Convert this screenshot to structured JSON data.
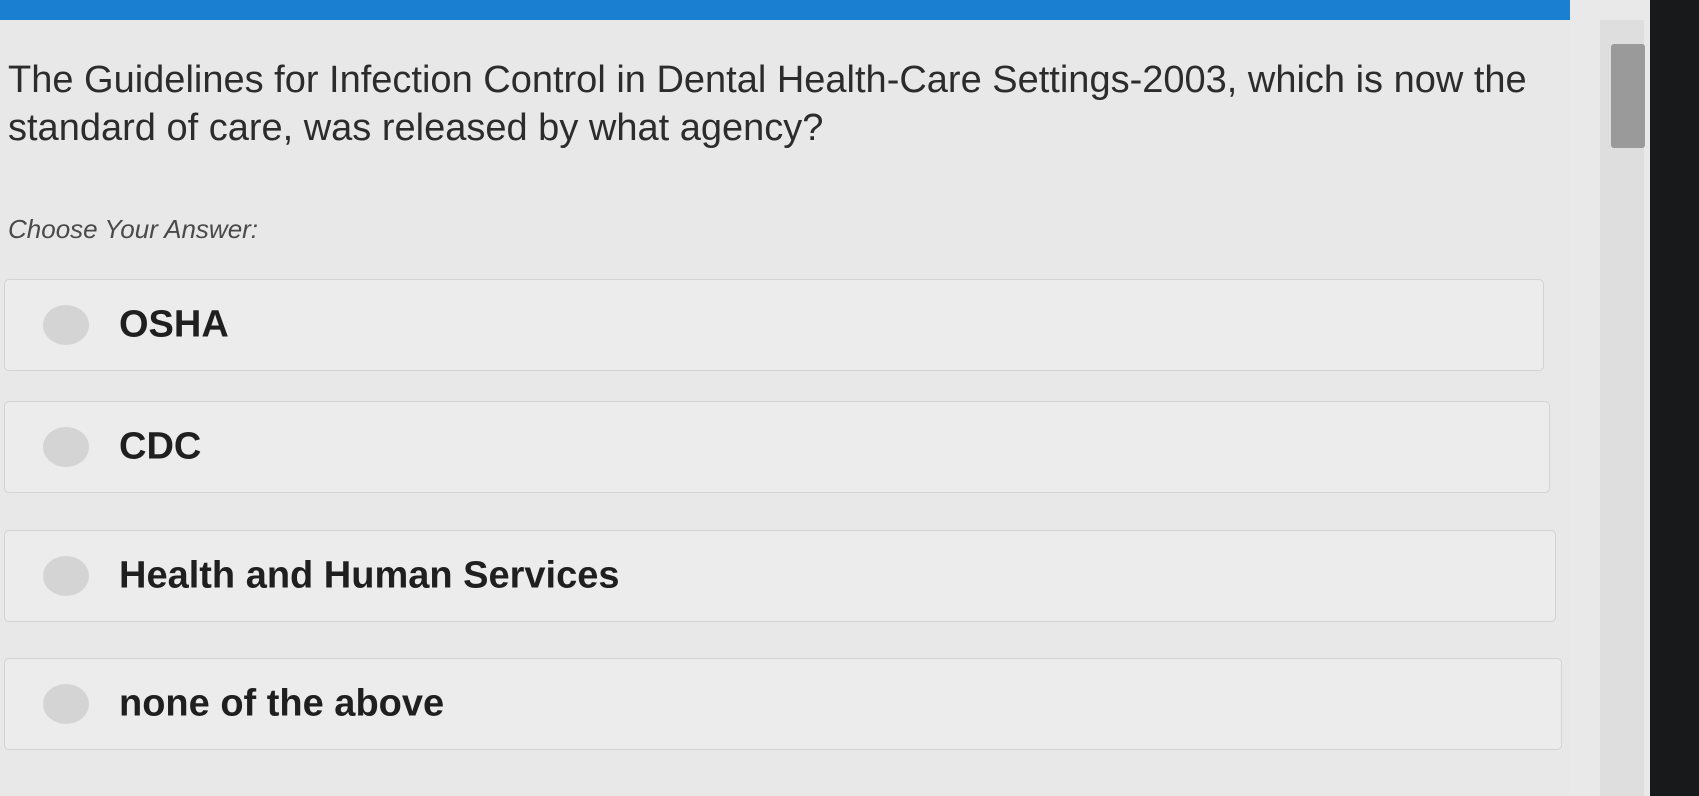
{
  "question": {
    "text": "The Guidelines for Infection Control in Dental Health-Care Settings-2003, which is now the standard of care, was released by what agency?"
  },
  "choose_label": "Choose Your Answer:",
  "options": [
    {
      "label": "OSHA"
    },
    {
      "label": "CDC"
    },
    {
      "label": "Health and Human Services"
    },
    {
      "label": "none of the above"
    }
  ],
  "colors": {
    "accent_bar": "#1a7fd0",
    "background": "#e8e8e8",
    "radio": "#d4d4d4",
    "text": "#1f1f1f"
  }
}
